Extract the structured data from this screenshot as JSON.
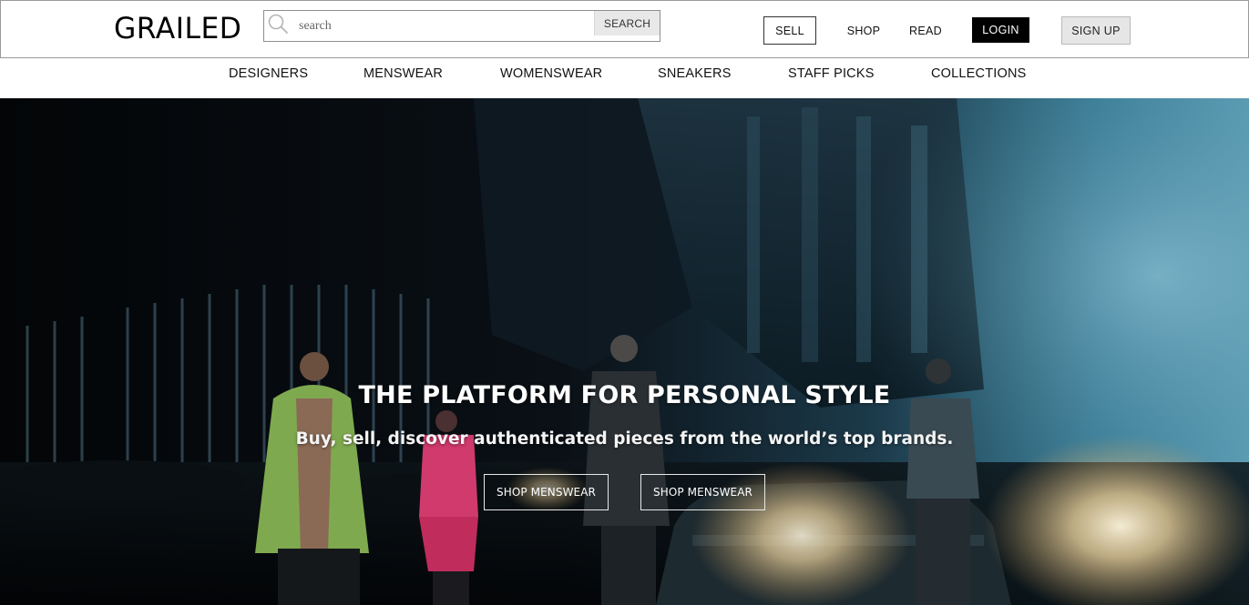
{
  "brand": {
    "logo_text": "GRAILED"
  },
  "search": {
    "placeholder": "search",
    "button_label": "SEARCH"
  },
  "header_nav": {
    "sell": "SELL",
    "shop": "SHOP",
    "read": "READ",
    "login": "LOGIN",
    "signup": "SIGN UP"
  },
  "categories": [
    {
      "label": "DESIGNERS"
    },
    {
      "label": "MENSWEAR"
    },
    {
      "label": "WOMENSWEAR"
    },
    {
      "label": "SNEAKERS"
    },
    {
      "label": "STAFF PICKS"
    },
    {
      "label": "COLLECTIONS"
    }
  ],
  "hero": {
    "title": "THE PLATFORM FOR PERSONAL STYLE",
    "subtitle": "Buy, sell, discover authenticated pieces from the world’s top brands.",
    "buttons": [
      {
        "label": "SHOP MENSWEAR"
      },
      {
        "label": "SHOP MENSWEAR"
      }
    ]
  },
  "icons": {
    "search": "search-icon"
  },
  "colors": {
    "login_bg": "#000000",
    "signup_bg": "#e6e6e6",
    "hero_teal": "#2f6f86"
  }
}
